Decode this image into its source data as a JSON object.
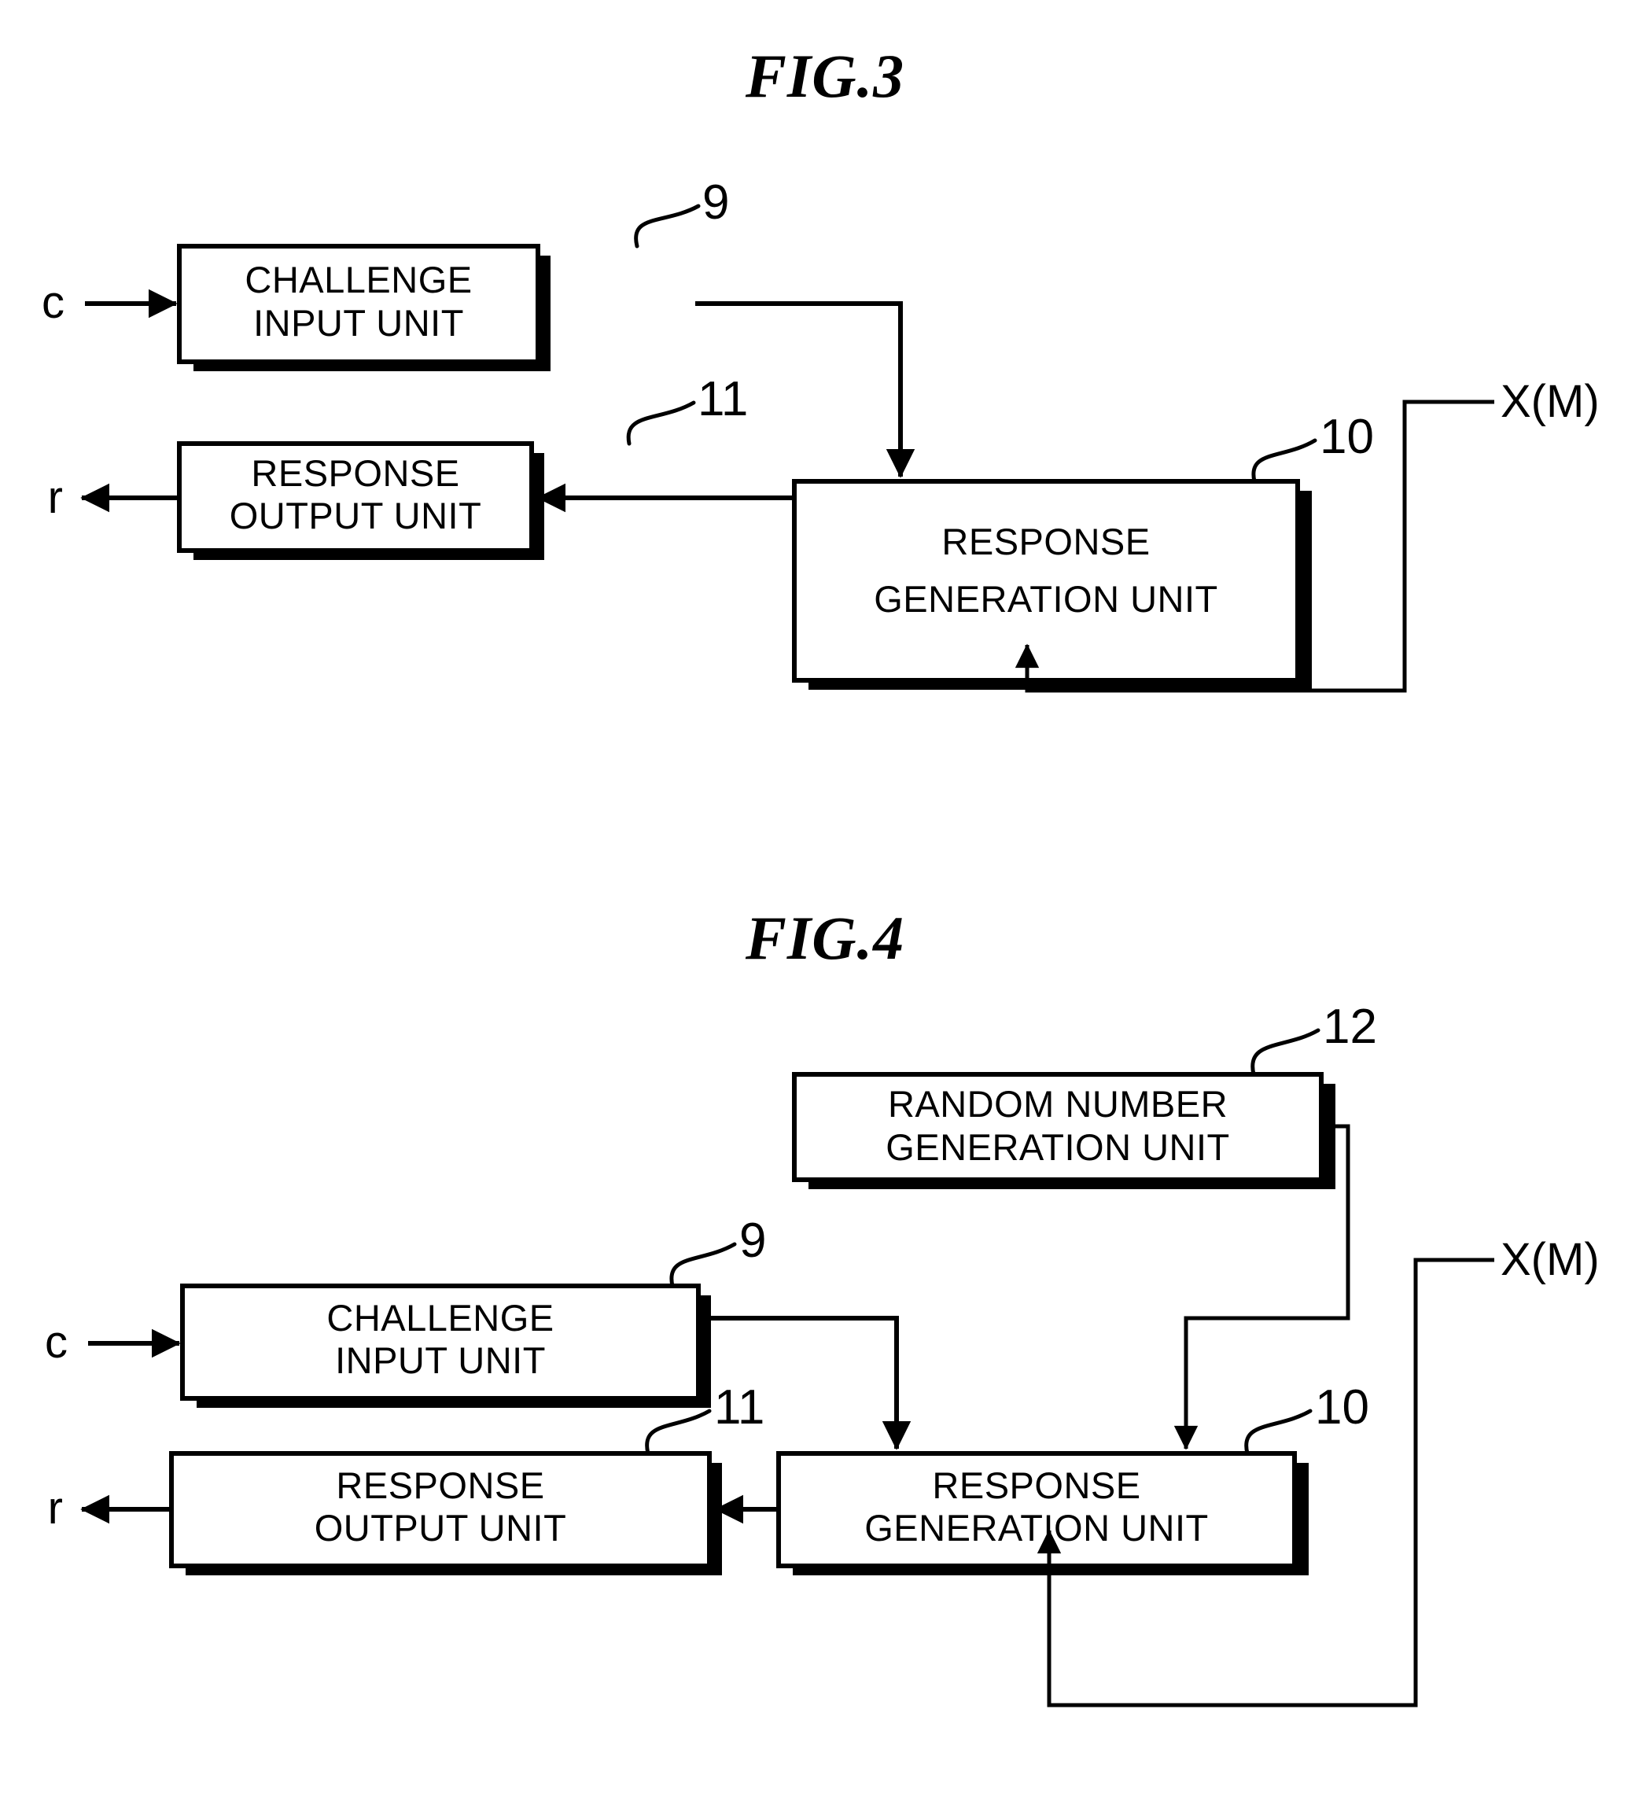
{
  "document": {
    "kind": "patent-drawing-sheet",
    "background_color": "#ffffff",
    "ink_color": "#000000"
  },
  "figures": [
    {
      "id": "fig3",
      "title": "FIG.3",
      "blocks": [
        {
          "ref": "9",
          "line1": "CHALLENGE",
          "line2": "INPUT UNIT"
        },
        {
          "ref": "11",
          "line1": "RESPONSE",
          "line2": "OUTPUT UNIT"
        },
        {
          "ref": "10",
          "line1": "RESPONSE",
          "line2": "GENERATION UNIT"
        }
      ],
      "signals": [
        {
          "name": "challenge-in",
          "label": "c"
        },
        {
          "name": "response-out",
          "label": "r"
        },
        {
          "name": "secret-input",
          "label": "X(M)"
        }
      ]
    },
    {
      "id": "fig4",
      "title": "FIG.4",
      "blocks": [
        {
          "ref": "12",
          "line1": "RANDOM NUMBER",
          "line2": "GENERATION UNIT"
        },
        {
          "ref": "9",
          "line1": "CHALLENGE",
          "line2": "INPUT UNIT"
        },
        {
          "ref": "11",
          "line1": "RESPONSE",
          "line2": "OUTPUT UNIT"
        },
        {
          "ref": "10",
          "line1": "RESPONSE",
          "line2": "GENERATION UNIT"
        }
      ],
      "signals": [
        {
          "name": "challenge-in",
          "label": "c"
        },
        {
          "name": "response-out",
          "label": "r"
        },
        {
          "name": "secret-input",
          "label": "X(M)"
        }
      ]
    }
  ]
}
